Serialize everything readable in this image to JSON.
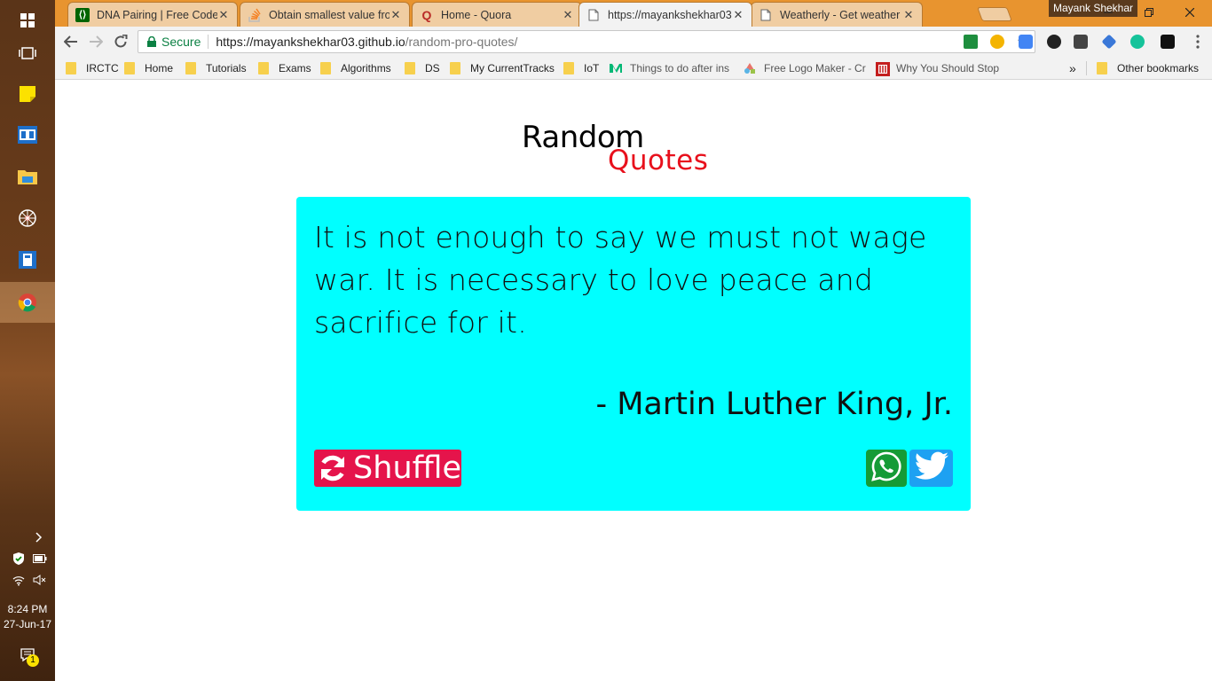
{
  "browser": {
    "tabs": [
      {
        "title": "DNA Pairing | Free Code",
        "favicon": "fcc-icon",
        "favicon_color": "#006400"
      },
      {
        "title": "Obtain smallest value fro",
        "favicon": "stackoverflow-icon",
        "favicon_color": "#f48024"
      },
      {
        "title": "Home - Quora",
        "favicon": "quora-icon",
        "favicon_color": "#b92b27"
      },
      {
        "title": "https://mayankshekhar03",
        "favicon": "page-icon",
        "active": true
      },
      {
        "title": "Weatherly - Get weather",
        "favicon": "page-icon"
      }
    ],
    "close_glyph": "✕",
    "profile_name": "Mayank Shekhar",
    "omnibox": {
      "secure_label": "Secure",
      "url_host": "https://mayankshekhar03.github.io",
      "url_path": "/random-pro-quotes/"
    },
    "bookmarks": [
      {
        "label": "IRCTC",
        "type": "folder"
      },
      {
        "label": "Home",
        "type": "folder"
      },
      {
        "label": "Tutorials",
        "type": "folder"
      },
      {
        "label": "Exams",
        "type": "folder"
      },
      {
        "label": "Algorithms",
        "type": "folder"
      },
      {
        "label": "DS",
        "type": "folder"
      },
      {
        "label": "My CurrentTracks",
        "type": "folder"
      },
      {
        "label": "IoT",
        "type": "folder"
      },
      {
        "label": "Things to do after ins",
        "type": "link",
        "icon": "medium-icon"
      },
      {
        "label": "Free Logo Maker - Cr",
        "type": "link",
        "icon": "logo-maker-icon"
      },
      {
        "label": "Why You Should Stop",
        "type": "link",
        "icon": "article-icon"
      }
    ],
    "overflow_label": "»",
    "other_bookmarks": "Other bookmarks"
  },
  "taskbar": {
    "time": "8:24 PM",
    "date": "27-Jun-17",
    "notification_count": "1"
  },
  "page": {
    "logo_top": "Random",
    "logo_bottom": "Quotes",
    "quote": "It is not enough to say we must not wage war. It is necessary to love peace and sacrifice for it.",
    "author": "- Martin Luther King, Jr.",
    "shuffle_label": "Shuffle",
    "colors": {
      "card": "#00ffff",
      "shuffle": "#e5144b",
      "whatsapp": "#159b36",
      "twitter": "#1da1f2",
      "logo_accent": "#e8101c",
      "tabstrip": "#e8942f"
    }
  }
}
